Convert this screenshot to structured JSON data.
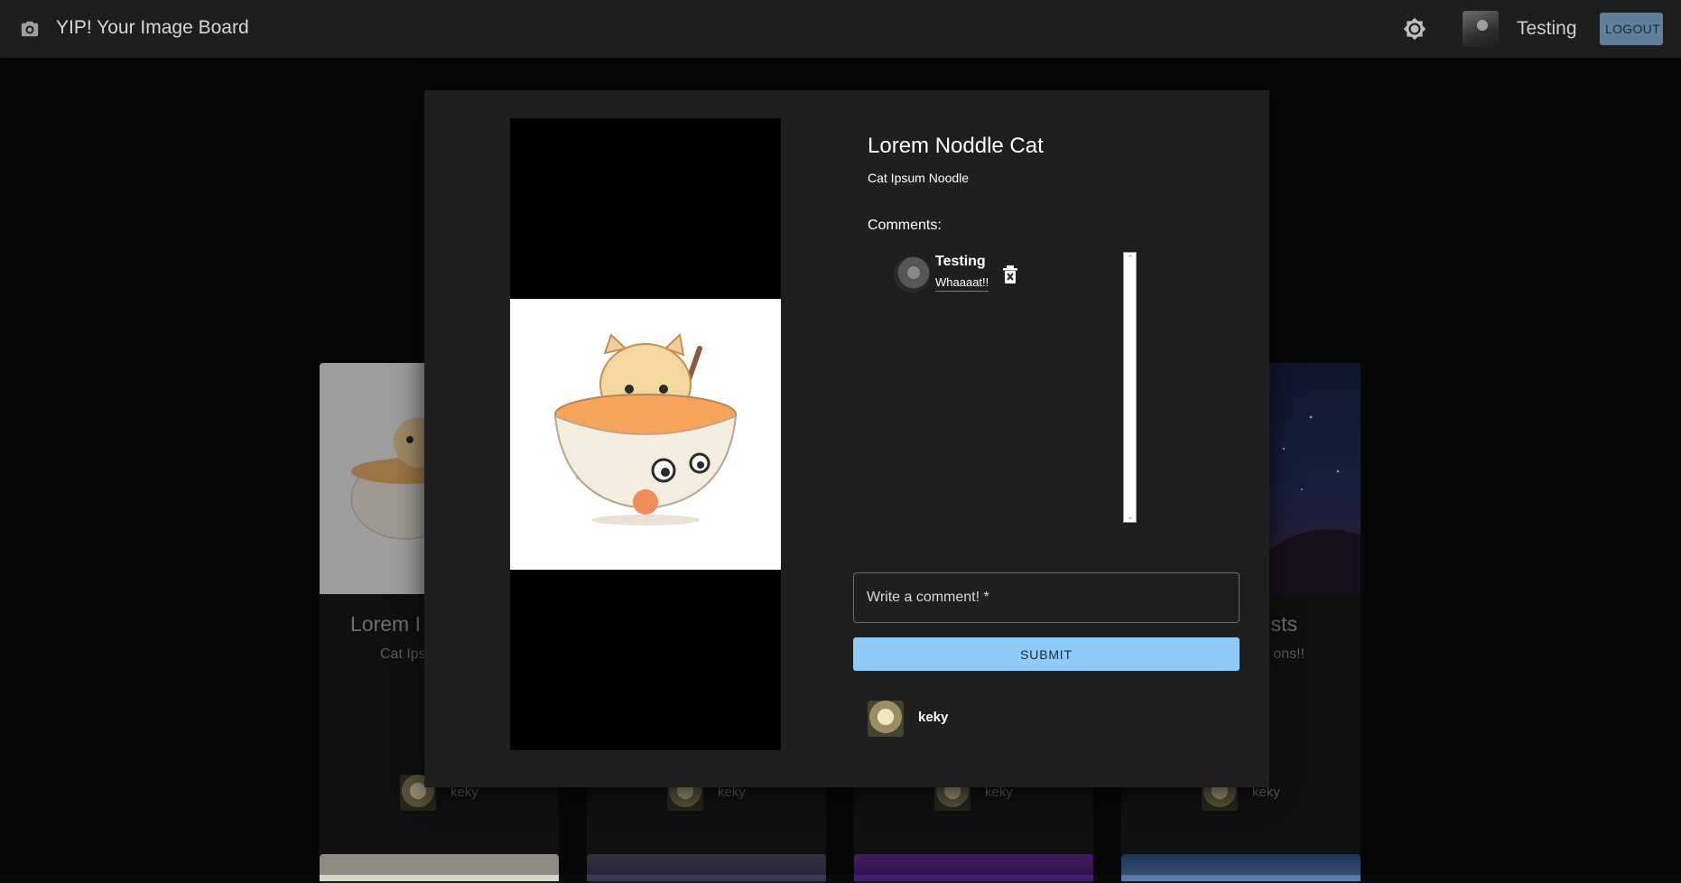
{
  "app": {
    "title": "YIP! Your Image Board",
    "brand_icon": "camera-icon",
    "theme_icon": "brightness-icon"
  },
  "header": {
    "username": "Testing",
    "logout_label": "LOGOUT"
  },
  "background_cards": [
    {
      "title_fragment": "Lorem I",
      "desc_fragment": "Cat Ips",
      "user": "keky"
    },
    {
      "user": "keky"
    },
    {
      "user": "keky"
    },
    {
      "title_fragment": "sts",
      "desc_fragment": "ons!!",
      "user": "keky"
    }
  ],
  "modal": {
    "title": "Lorem Noddle Cat",
    "description": "Cat Ipsum Noodle",
    "comments_label": "Comments:",
    "comments": [
      {
        "author": "Testing",
        "text": "Whaaaat!!",
        "delete_icon": "delete-icon"
      }
    ],
    "comment_placeholder": "Write a comment! *",
    "submit_label": "SUBMIT",
    "owner": "keky"
  },
  "colors": {
    "accent": "#90caf9",
    "logout_bg": "#5f7f9c",
    "modal_bg": "#1f1f1f"
  }
}
